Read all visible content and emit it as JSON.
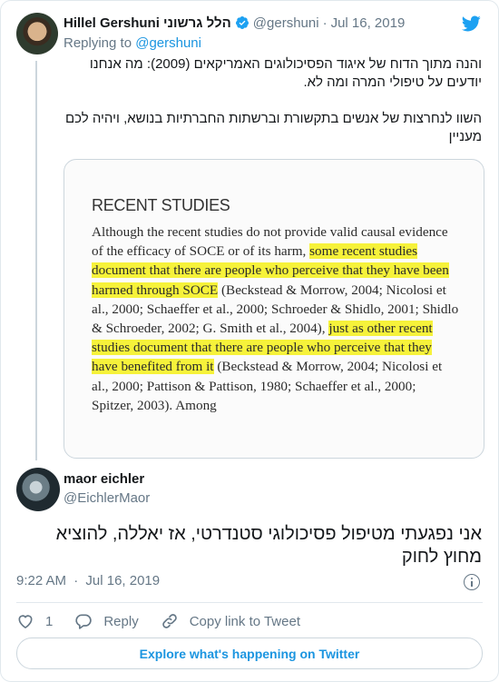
{
  "tweet": {
    "author_name": "Hillel Gershuni הלל גרשוני",
    "handle": "@gershuni",
    "separator": "·",
    "date": "Jul 16, 2019",
    "replying_prefix": "Replying to",
    "replying_handle": "@gershuni",
    "paragraph1": "והנה מתוך הדוח של איגוד הפסיכולוגים האמריקאים (2009): מה אנחנו יודעים על טיפולי המרה ומה לא.",
    "paragraph2": "השוו לנחרצות של אנשים בתקשורת וברשתות החברתיות בנושא, ויהיה לכם מעניין",
    "media": {
      "heading": "RECENT STUDIES",
      "seg1": "Although the recent studies do not provide valid causal evidence of the efficacy of SOCE or of its harm, ",
      "hl1": "some recent studies document that there are people who perceive that they have been harmed through SOCE",
      "seg2": " (Beckstead & Morrow, 2004; Nicolosi et al., 2000; Schaeffer et al., 2000; Schroeder & Shidlo, 2001; Shidlo & Schroeder, 2002; G. Smith et al., 2004), ",
      "hl2": "just as other recent studies document that there are people who perceive that they have benefited from it",
      "seg3": " (Beckstead & Morrow, 2004; Nicolosi et al., 2000; Pattison & Pattison, 1980; Schaeffer et al., 2000; Spitzer, 2003). Among"
    }
  },
  "reply": {
    "author_name": "maor eichler",
    "handle": "@EichlerMaor",
    "text": "אני נפגעתי מטיפול פסיכולוגי סטנדרטי, אז יאללה, להוציא מחוץ לחוק",
    "time": "9:22 AM",
    "separator": "·",
    "date": "Jul 16, 2019",
    "likes": "1",
    "reply_label": "Reply",
    "copy_label": "Copy link to Tweet"
  },
  "explore_label": "Explore what's happening on Twitter",
  "icons": {
    "brand": "twitter-bird-icon",
    "verified": "verified-badge-icon",
    "info": "info-icon",
    "like": "heart-icon",
    "reply": "reply-bubble-icon",
    "copy": "link-icon"
  },
  "colors": {
    "brand": "#1da1f2",
    "link": "#1b95e0",
    "highlight": "#f6f23a",
    "muted": "#657786"
  }
}
